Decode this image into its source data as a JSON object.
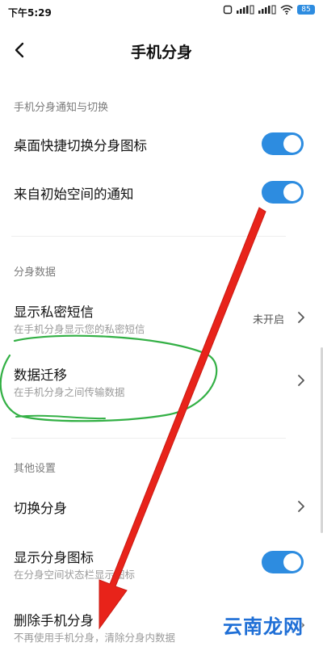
{
  "status_bar": {
    "time": "下午5:29",
    "battery": "85",
    "icons": [
      "notification-icon",
      "signal-icon",
      "signal-icon",
      "wifi-icon",
      "battery-icon"
    ]
  },
  "header": {
    "title": "手机分身",
    "back_icon": "chevron-left-icon"
  },
  "sections": {
    "notify": {
      "title": "手机分身通知与切换",
      "items": [
        {
          "label": "桌面快捷切换分身图标",
          "toggle": true
        },
        {
          "label": "来自初始空间的通知",
          "toggle": true
        }
      ]
    },
    "data": {
      "title": "分身数据",
      "items": [
        {
          "label": "显示私密短信",
          "subtitle": "在手机分身显示您的私密短信",
          "value": "未开启"
        },
        {
          "label": "数据迁移",
          "subtitle": "在手机分身之间传输数据"
        }
      ]
    },
    "other": {
      "title": "其他设置",
      "items": [
        {
          "label": "切换分身"
        },
        {
          "label": "显示分身图标",
          "subtitle": "在分身空间状态栏显示图标",
          "toggle": true
        },
        {
          "label": "删除手机分身",
          "subtitle": "不再使用手机分身，清除分身内数据"
        }
      ]
    }
  },
  "colors": {
    "accent": "#2d8ce0",
    "annotation_red": "#e8231a",
    "annotation_green": "#33b045"
  },
  "watermark": "云南龙网"
}
